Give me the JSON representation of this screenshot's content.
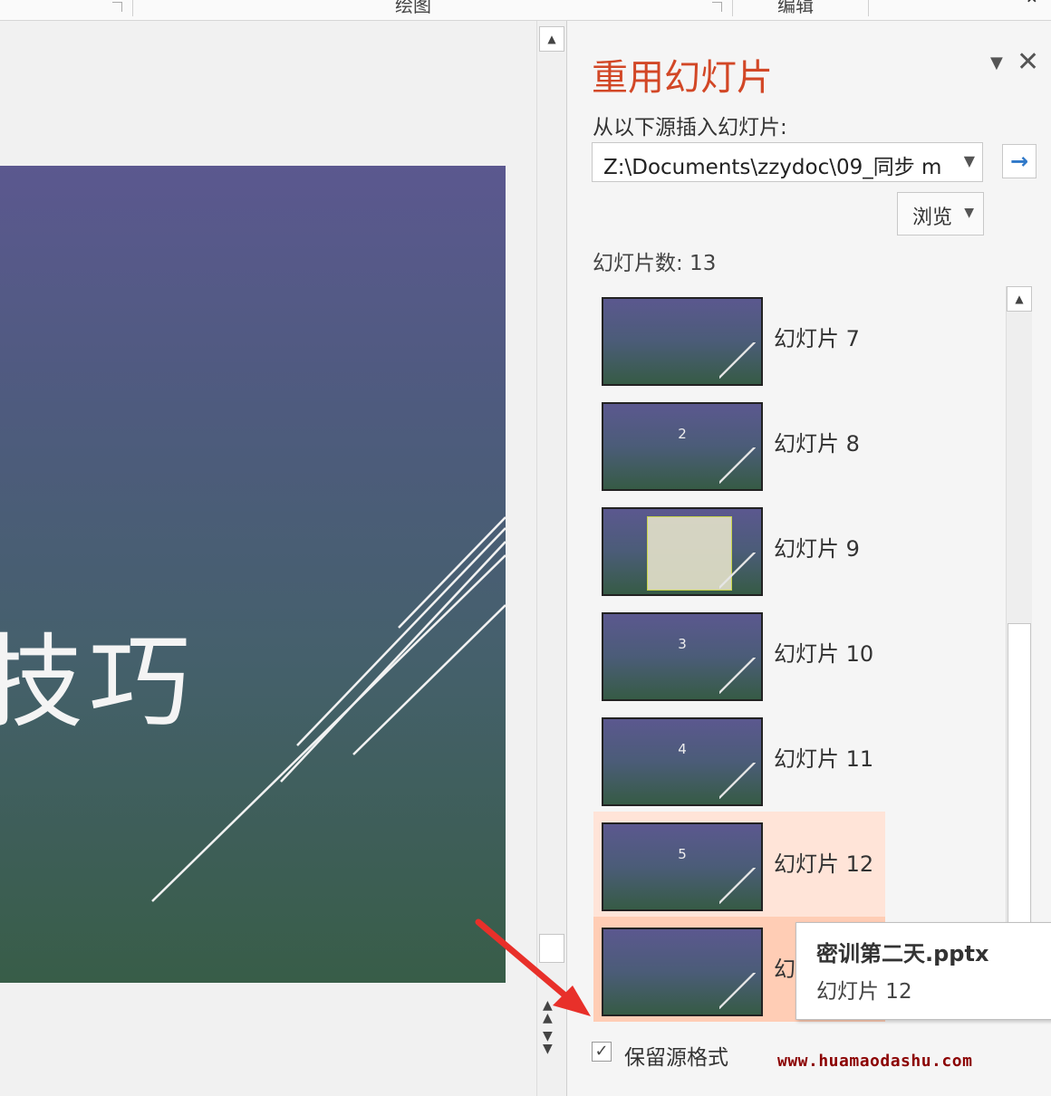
{
  "ribbon": {
    "group_drawing": "绘图",
    "group_edit": "编辑",
    "collapse_icon": "chevron-up-icon"
  },
  "slide": {
    "title": "技巧"
  },
  "pane": {
    "title": "重用幻灯片",
    "menu_icon": "▼",
    "close_icon": "✕",
    "source_label": "从以下源插入幻灯片:",
    "source_value": "Z:\\Documents\\zzydoc\\09_同步 m",
    "go_icon": "→",
    "browse_label": "浏览",
    "slide_count": "幻灯片数: 13",
    "keep_format_label": "保留源格式",
    "keep_format_checked": true
  },
  "slides": [
    {
      "label": "幻灯片 7",
      "num": "",
      "text": "",
      "variant": "title"
    },
    {
      "label": "幻灯片 8",
      "num": "2",
      "text": "",
      "variant": "section"
    },
    {
      "label": "幻灯片 9",
      "num": "",
      "text": "",
      "variant": "table"
    },
    {
      "label": "幻灯片 10",
      "num": "3",
      "text": "",
      "variant": "section"
    },
    {
      "label": "幻灯片 11",
      "num": "4",
      "text": "",
      "variant": "section"
    },
    {
      "label": "幻灯片 12",
      "num": "5",
      "text": "",
      "variant": "section",
      "state": "hover"
    },
    {
      "label": "幻",
      "num": "",
      "text": "",
      "variant": "plain",
      "state": "selected"
    }
  ],
  "tooltip": {
    "file": "密训第二天.pptx",
    "slide": "幻灯片 12"
  },
  "watermark": "www.huamaodashu.com",
  "colors": {
    "accent_title": "#d24726",
    "hover_bg": "#ffe4d8",
    "selected_bg": "#ffcdb5",
    "arrow": "#e8302a",
    "watermark": "#8b0000"
  }
}
